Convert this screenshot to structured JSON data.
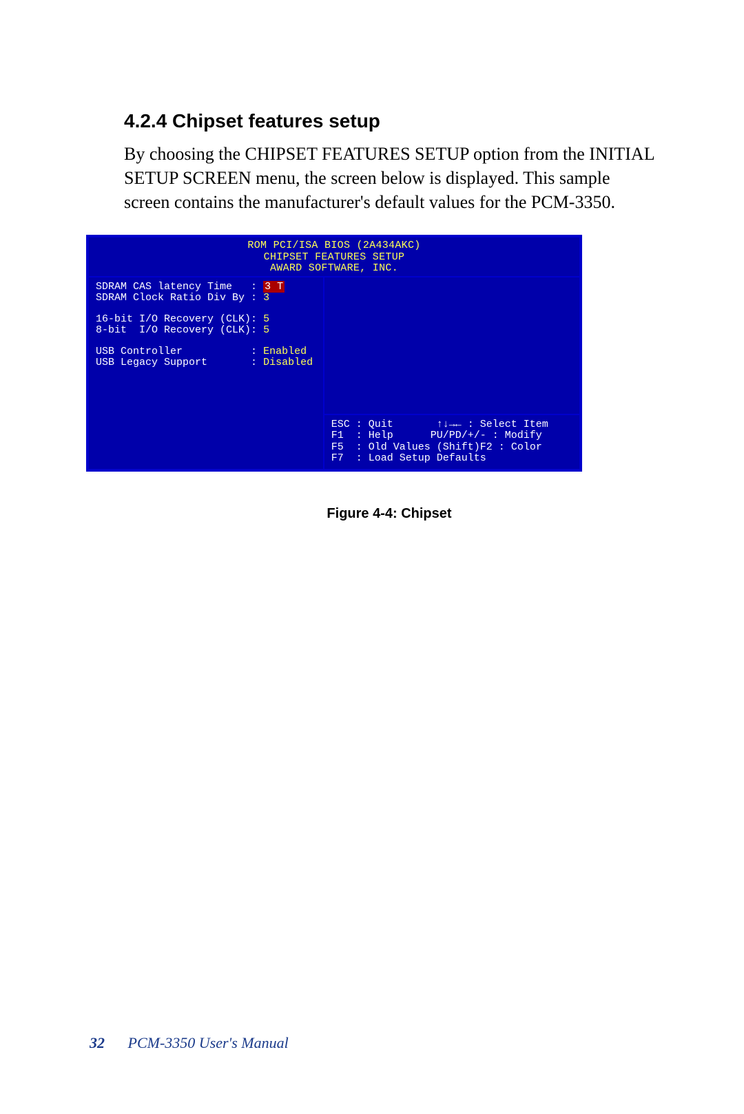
{
  "heading": "4.2.4 Chipset features setup",
  "paragraph": "By choosing the CHIPSET FEATURES SETUP option from the INITIAL SETUP SCREEN menu, the screen below is displayed. This sample screen contains the manufacturer's default values for the PCM-3350.",
  "bios": {
    "header_lines": [
      "ROM PCI/ISA BIOS (2A434AKC)",
      "CHIPSET FEATURES SETUP",
      "AWARD SOFTWARE, INC."
    ],
    "options": [
      {
        "label": "SDRAM CAS latency Time  ",
        "sep": " : ",
        "value": "3 T",
        "selected": true
      },
      {
        "label": "SDRAM Clock Ratio Div By",
        "sep": " : ",
        "value": "3",
        "selected": false
      },
      {
        "spacer": true
      },
      {
        "label": "16-bit I/O Recovery (CLK)",
        "sep": ": ",
        "value": "5",
        "selected": false
      },
      {
        "label": "8-bit  I/O Recovery (CLK)",
        "sep": ": ",
        "value": "5",
        "selected": false
      },
      {
        "spacer": true
      },
      {
        "label": "USB Controller          ",
        "sep": " : ",
        "value": "Enabled",
        "selected": false
      },
      {
        "label": "USB Legacy Support      ",
        "sep": " : ",
        "value": "Disabled",
        "selected": false
      }
    ],
    "help": {
      "l1a": "ESC : Quit",
      "l1b": "↑↓→← : Select Item",
      "l2a": "F1  : Help",
      "l2b": "PU/PD/+/- : Modify",
      "l3a": "F5  : Old Values",
      "l3b": "(Shift)F2 : Color",
      "l4": "F7  : Load Setup Defaults"
    }
  },
  "figure_caption": "Figure 4-4: Chipset",
  "footer": {
    "page_number": "32",
    "doc_title": "PCM-3350  User's Manual"
  }
}
